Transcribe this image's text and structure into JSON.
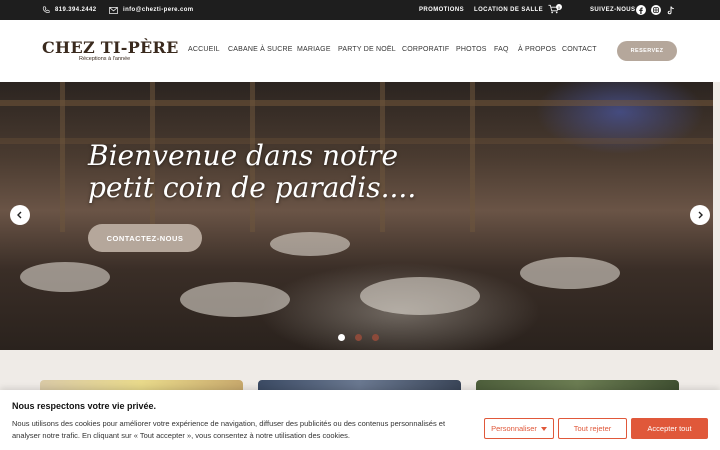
{
  "topbar": {
    "phone": "819.394.2442",
    "email": "info@chezti-pere.com",
    "links": [
      "PROMOTIONS",
      "LOCATION DE SALLE"
    ],
    "cart_count": "0",
    "follow": "SUIVEZ-NOUS"
  },
  "header": {
    "logo": "CHEZ TI-PÈRE",
    "tagline": "Réceptions à l'année",
    "nav": [
      "ACCUEIL",
      "CABANE À SUCRE",
      "MARIAGE",
      "PARTY DE NOËL",
      "CORPORATIF",
      "PHOTOS",
      "FAQ",
      "À PROPOS",
      "CONTACT"
    ],
    "reserve": "RESERVEZ"
  },
  "hero": {
    "title_line1": "Bienvenue dans notre",
    "title_line2": "petit coin de paradis....",
    "cta": "CONTACTEZ-NOUS",
    "slides": 3,
    "active_slide": 1
  },
  "cookie": {
    "title": "Nous respectons votre vie privée.",
    "text": "Nous utilisons des cookies pour améliorer votre expérience de navigation, diffuser des publicités ou des contenus personnalisés et analyser notre trafic. En cliquant sur « Tout accepter », vous consentez à notre utilisation des cookies.",
    "customize": "Personnaliser",
    "reject": "Tout rejeter",
    "accept": "Accepter tout"
  },
  "colors": {
    "accent": "#e0583a",
    "brand_tan": "#b5a79b",
    "dark": "#1e1e1e"
  }
}
